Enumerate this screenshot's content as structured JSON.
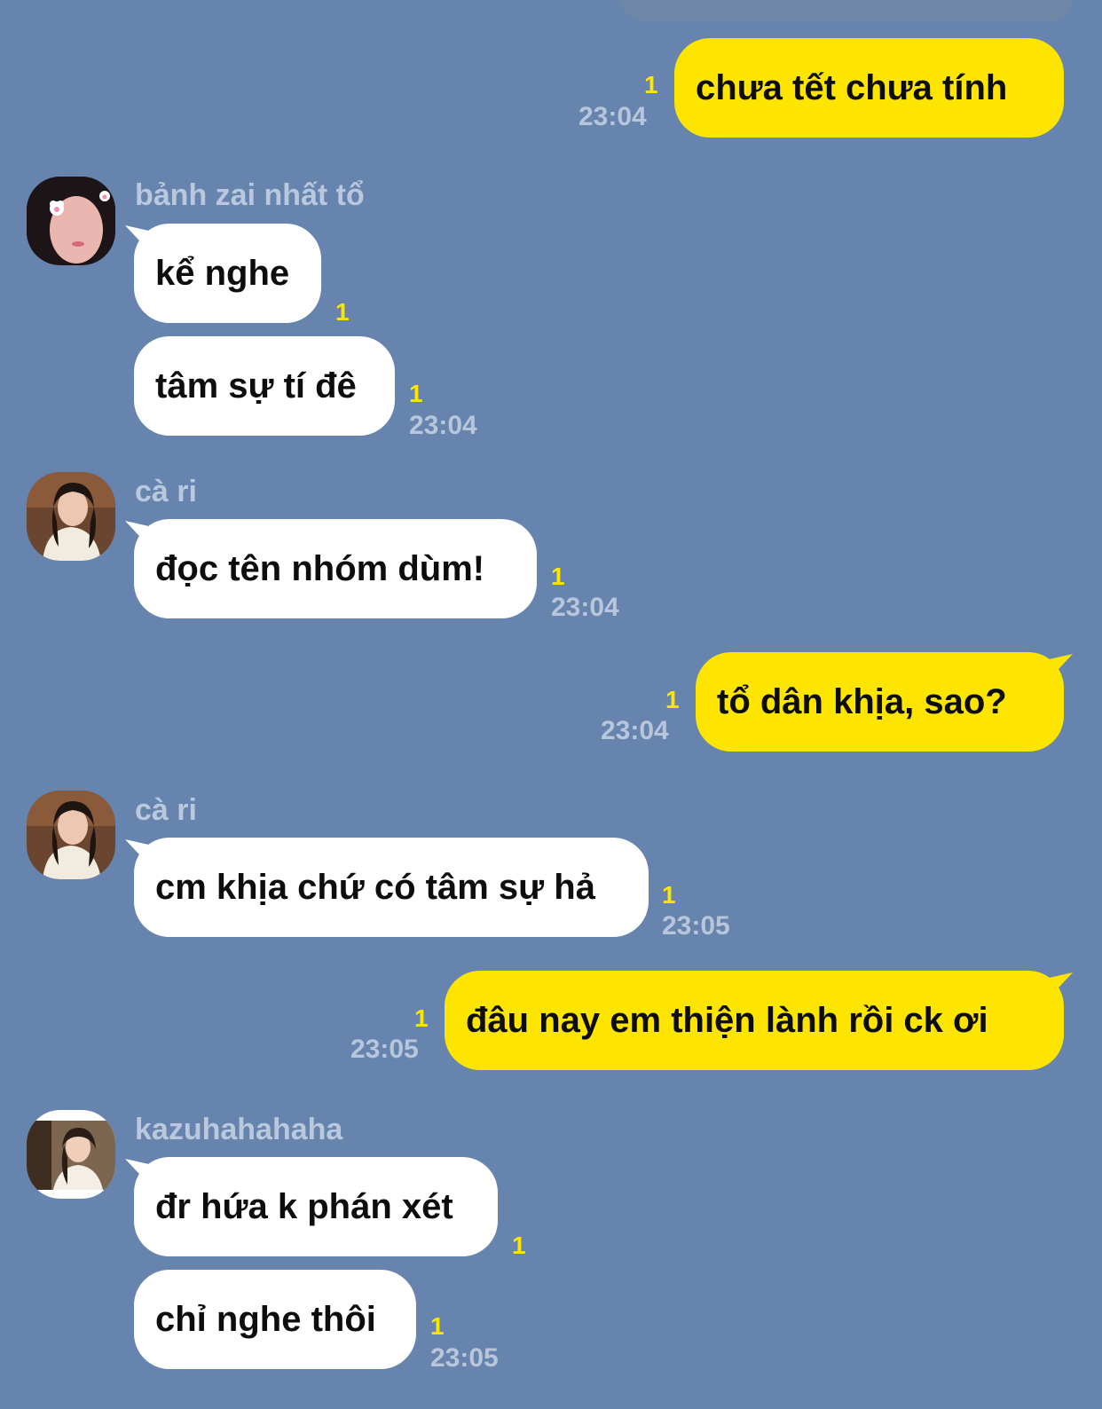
{
  "chat": {
    "messages": [
      {
        "id": "m1",
        "direction": "outgoing",
        "text": "chưa tết chưa tính",
        "unread": "1",
        "time": "23:04"
      },
      {
        "id": "m2",
        "direction": "incoming",
        "sender": "bảnh zai nhất tổ",
        "text": "kể nghe",
        "unread": "1"
      },
      {
        "id": "m3",
        "direction": "incoming",
        "sender": "bảnh zai nhất tổ",
        "text": "tâm sự tí đê",
        "unread": "1",
        "time": "23:04"
      },
      {
        "id": "m4",
        "direction": "incoming",
        "sender": "cà ri",
        "text": "đọc tên nhóm dùm!",
        "unread": "1",
        "time": "23:04"
      },
      {
        "id": "m5",
        "direction": "outgoing",
        "text": "tổ dân khịa, sao?",
        "unread": "1",
        "time": "23:04"
      },
      {
        "id": "m6",
        "direction": "incoming",
        "sender": "cà ri",
        "text": "cm khịa chứ có tâm sự hả",
        "unread": "1",
        "time": "23:05"
      },
      {
        "id": "m7",
        "direction": "outgoing",
        "text": "đâu nay em thiện lành rồi ck ơi",
        "unread": "1",
        "time": "23:05"
      },
      {
        "id": "m8",
        "direction": "incoming",
        "sender": "kazuhahahaha",
        "text": "đr hứa k phán xét",
        "unread": "1"
      },
      {
        "id": "m9",
        "direction": "incoming",
        "sender": "kazuhahahaha",
        "text": "chỉ nghe thôi",
        "unread": "1",
        "time": "23:05"
      }
    ]
  },
  "colors": {
    "background": "#6684ae",
    "outgoing_bubble": "#fee500",
    "incoming_bubble": "#ffffff",
    "unread_count": "#fee500",
    "timestamp": "#b7c6da"
  }
}
